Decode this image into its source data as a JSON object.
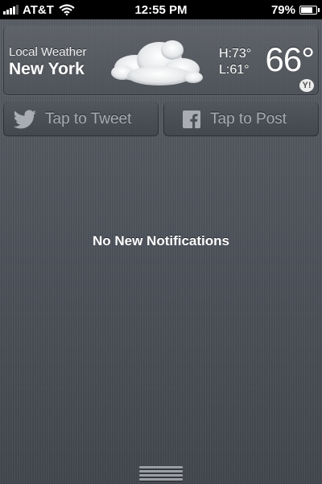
{
  "status_bar": {
    "carrier": "AT&T",
    "time": "12:55 PM",
    "battery_percent": "79%",
    "battery_level": 0.79,
    "signal_bars": 4,
    "wifi_icon": "wifi-icon"
  },
  "weather": {
    "label": "Local Weather",
    "city": "New York",
    "high": "H:73°",
    "low": "L:61°",
    "temperature": "66°",
    "condition_icon": "cloud-icon",
    "provider_icon": "yahoo-icon",
    "provider_mark": "Y!"
  },
  "share": {
    "tweet_label": "Tap to Tweet",
    "tweet_icon": "twitter-bird-icon",
    "post_label": "Tap to Post",
    "post_icon": "facebook-icon"
  },
  "notifications": {
    "empty_message": "No New Notifications"
  },
  "colors": {
    "background": "#4e535b",
    "statusbar": "#000000",
    "button_text": "#a9adb3"
  }
}
